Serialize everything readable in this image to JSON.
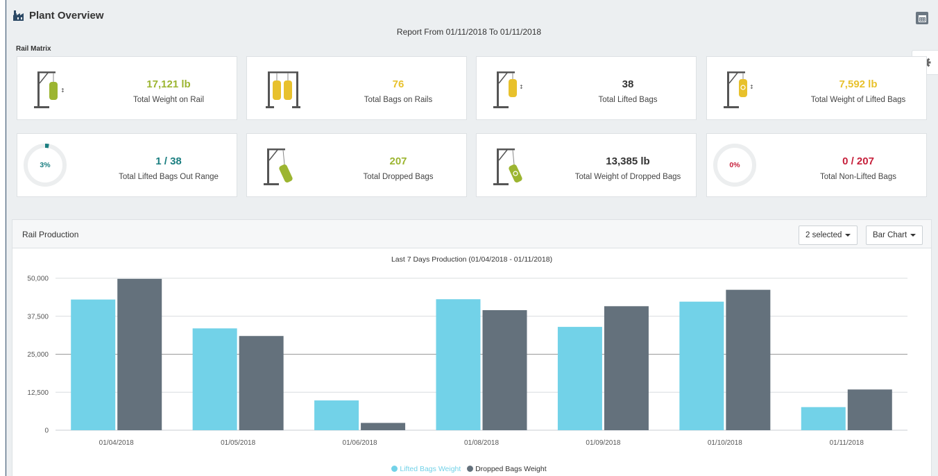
{
  "header": {
    "title": "Plant Overview",
    "report_range": "Report From 01/11/2018 To 01/11/2018"
  },
  "icons": {
    "title": "factory-icon",
    "calendar": "calendar-icon",
    "settings": "gear-icon"
  },
  "section_label": "Rail Matrix",
  "cards": [
    {
      "value": "17,121 lb",
      "label": "Total Weight on Rail",
      "color": "#9cb531",
      "icon": "single-bag-rail-icon"
    },
    {
      "value": "76",
      "label": "Total Bags on Rails",
      "color": "#e8c12c",
      "icon": "double-bag-rail-icon"
    },
    {
      "value": "38",
      "label": "Total Lifted Bags",
      "color": "#333333",
      "icon": "lifted-bag-icon"
    },
    {
      "value": "7,592 lb",
      "label": "Total Weight of Lifted Bags",
      "color": "#e8c12c",
      "icon": "lifted-bag-weight-icon"
    },
    {
      "value": "1 / 38",
      "label": "Total Lifted Bags Out Range",
      "color": "#1a7e80",
      "ring_pct": "3%",
      "ring_fraction": 0.03
    },
    {
      "value": "207",
      "label": "Total Dropped Bags",
      "color": "#9cb531",
      "icon": "dropped-bag-icon"
    },
    {
      "value": "13,385 lb",
      "label": "Total Weight of Dropped Bags",
      "color": "#333333",
      "icon": "dropped-bag-weight-icon"
    },
    {
      "value": "0 / 207",
      "label": "Total Non-Lifted Bags",
      "color": "#c6203b",
      "ring_pct": "0%",
      "ring_fraction": 0
    }
  ],
  "panel": {
    "title": "Rail Production",
    "series_select": "2 selected",
    "chart_type_select": "Bar Chart"
  },
  "chart_data": {
    "type": "bar",
    "title": "Last 7 Days Production (01/04/2018 - 01/11/2018)",
    "categories": [
      "01/04/2018",
      "01/05/2018",
      "01/06/2018",
      "01/08/2018",
      "01/09/2018",
      "01/10/2018",
      "01/11/2018"
    ],
    "series": [
      {
        "name": "Lifted Bags Weight",
        "color": "#72d2e8",
        "values": [
          43000,
          33500,
          9800,
          43100,
          34000,
          42300,
          7600
        ]
      },
      {
        "name": "Dropped Bags Weight",
        "color": "#64717c",
        "values": [
          49800,
          31000,
          2400,
          39500,
          40800,
          46200,
          13400
        ]
      }
    ],
    "yticks": [
      "50,000",
      "37,500",
      "25,000",
      "12,500",
      "0"
    ],
    "ylim": [
      0,
      50000
    ],
    "grid": true,
    "legend": "bottom-center"
  }
}
